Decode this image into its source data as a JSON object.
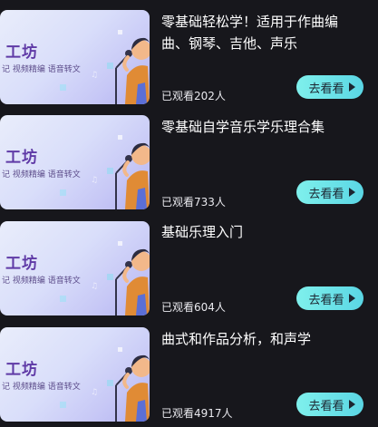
{
  "courses": [
    {
      "thumbnail_title": "工坊",
      "thumbnail_tags": "记  视频精编  语音转文",
      "title": "零基础轻松学！适用于作曲编曲、钢琴、吉他、声乐",
      "views": "已观看202人",
      "button_label": "去看看"
    },
    {
      "thumbnail_title": "工坊",
      "thumbnail_tags": "记  视频精编  语音转文",
      "title": "零基础自学音乐学乐理合集",
      "views": "已观看733人",
      "button_label": "去看看"
    },
    {
      "thumbnail_title": "工坊",
      "thumbnail_tags": "记  视频精编  语音转文",
      "title": "基础乐理入门",
      "views": "已观看604人",
      "button_label": "去看看"
    },
    {
      "thumbnail_title": "工坊",
      "thumbnail_tags": "记  视频精编  语音转文",
      "title": "曲式和作品分析，和声学",
      "views": "已观看4917人",
      "button_label": "去看看"
    }
  ],
  "colors": {
    "background": "#17171c",
    "button": "#6ee6e9",
    "thumbnail_text": "#5f3aa6"
  },
  "icons": {
    "button": "play-icon",
    "thumbnail_art": "singer-with-microphone"
  }
}
